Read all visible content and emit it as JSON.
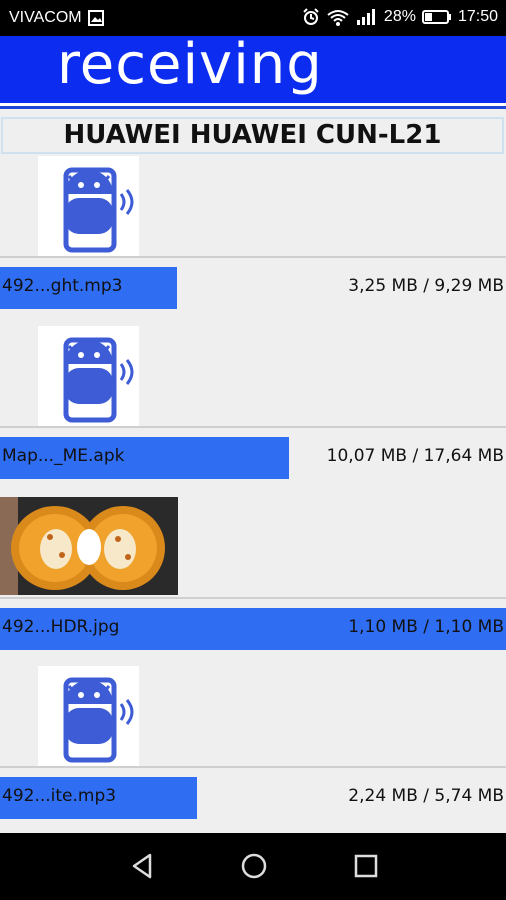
{
  "status_bar": {
    "carrier": "VIVACOM",
    "battery": "28%",
    "time": "17:50"
  },
  "header": {
    "title": "receiving"
  },
  "device_name": "HUAWEI HUAWEI CUN-L21",
  "transfers": [
    {
      "filename": "492...ght.mp3",
      "size": "3,25 MB / 9,29 MB",
      "progress": 0.35,
      "icon": "android-app-icon"
    },
    {
      "filename": "Map..._ME.apk",
      "size": "10,07 MB / 17,64 MB",
      "progress": 0.571,
      "icon": "android-app-icon"
    },
    {
      "filename": "492...HDR.jpg",
      "size": "1,10 MB / 1,10 MB",
      "progress": 1.0,
      "icon": "photo-thumbnail"
    },
    {
      "filename": "492...ite.mp3",
      "size": "2,24 MB / 5,74 MB",
      "progress": 0.39,
      "icon": "android-app-icon"
    }
  ],
  "nav": {
    "back": "back",
    "home": "home",
    "recents": "recents"
  },
  "colors": {
    "header_blue": "#0c2cf0",
    "progress_blue": "#2f6df2",
    "icon_blue": "#3d5cd6"
  }
}
